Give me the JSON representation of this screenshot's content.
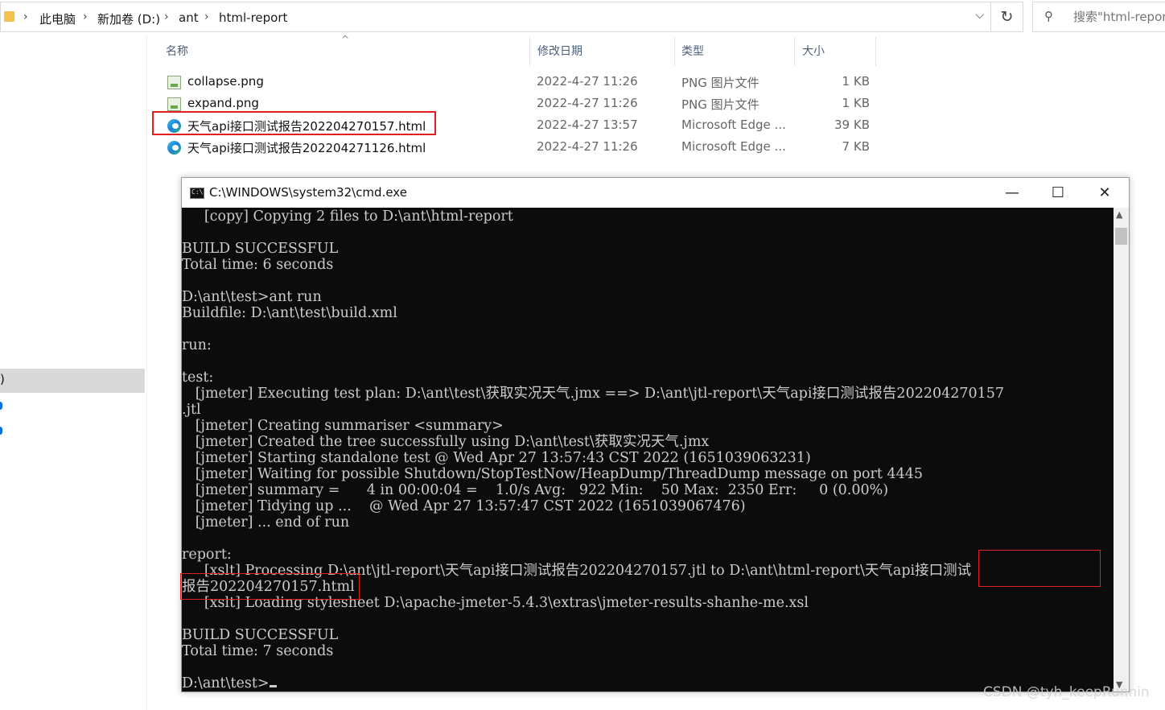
{
  "explorer": {
    "breadcrumbs": [
      "此电脑",
      "新加卷 (D:)",
      "ant",
      "html-report"
    ],
    "search_placeholder": "搜索\"html-report\"",
    "columns": [
      "名称",
      "修改日期",
      "类型",
      "大小"
    ],
    "files": [
      {
        "name": "collapse.png",
        "date": "2022-4-27 11:26",
        "type": "PNG 图片文件",
        "size": "1 KB",
        "icon": "png-file-icon"
      },
      {
        "name": "expand.png",
        "date": "2022-4-27 11:26",
        "type": "PNG 图片文件",
        "size": "1 KB",
        "icon": "png-file-icon"
      },
      {
        "name": "天气api接口测试报告202204270157.html",
        "date": "2022-4-27 13:57",
        "type": "Microsoft Edge ...",
        "size": "39 KB",
        "icon": "edge-html-icon",
        "highlighted": true
      },
      {
        "name": "天气api接口测试报告202204271126.html",
        "date": "2022-4-27 11:26",
        "type": "Microsoft Edge ...",
        "size": "7 KB",
        "icon": "edge-html-icon"
      }
    ],
    "nav_selected_label": ")",
    "highlight_color": "#e02020"
  },
  "cmd": {
    "title": "C:\\WINDOWS\\system32\\cmd.exe",
    "icon_label": "C:\\",
    "buttons": {
      "minimize": "—",
      "maximize": "☐",
      "close": "✕"
    },
    "lines": [
      "     [copy] Copying 2 files to D:\\ant\\html-report",
      "",
      "BUILD SUCCESSFUL",
      "Total time: 6 seconds",
      "",
      "D:\\ant\\test>ant run",
      "Buildfile: D:\\ant\\test\\build.xml",
      "",
      "run:",
      "",
      "test:",
      "   [jmeter] Executing test plan: D:\\ant\\test\\获取实况天气.jmx ==> D:\\ant\\jtl-report\\天气api接口测试报告202204270157",
      ".jtl",
      "   [jmeter] Creating summariser <summary>",
      "   [jmeter] Created the tree successfully using D:\\ant\\test\\获取实况天气.jmx",
      "   [jmeter] Starting standalone test @ Wed Apr 27 13:57:43 CST 2022 (1651039063231)",
      "   [jmeter] Waiting for possible Shutdown/StopTestNow/HeapDump/ThreadDump message on port 4445",
      "   [jmeter] summary =      4 in 00:00:04 =    1.0/s Avg:   922 Min:    50 Max:  2350 Err:     0 (0.00%)",
      "   [jmeter] Tidying up ...    @ Wed Apr 27 13:57:47 CST 2022 (1651039067476)",
      "   [jmeter] ... end of run",
      "",
      "report:",
      "     [xslt] Processing D:\\ant\\jtl-report\\天气api接口测试报告202204270157.jtl to D:\\ant\\html-report\\天气api接口测试",
      "报告202204270157.html",
      "     [xslt] Loading stylesheet D:\\apache-jmeter-5.4.3\\extras\\jmeter-results-shanhe-me.xsl",
      "",
      "BUILD SUCCESSFUL",
      "Total time: 7 seconds",
      "",
      "D:\\ant\\test>"
    ],
    "text_color": "#cccccc",
    "background": "#0c0c0c"
  },
  "watermark": "CSDN @tyh_keepRunnin"
}
